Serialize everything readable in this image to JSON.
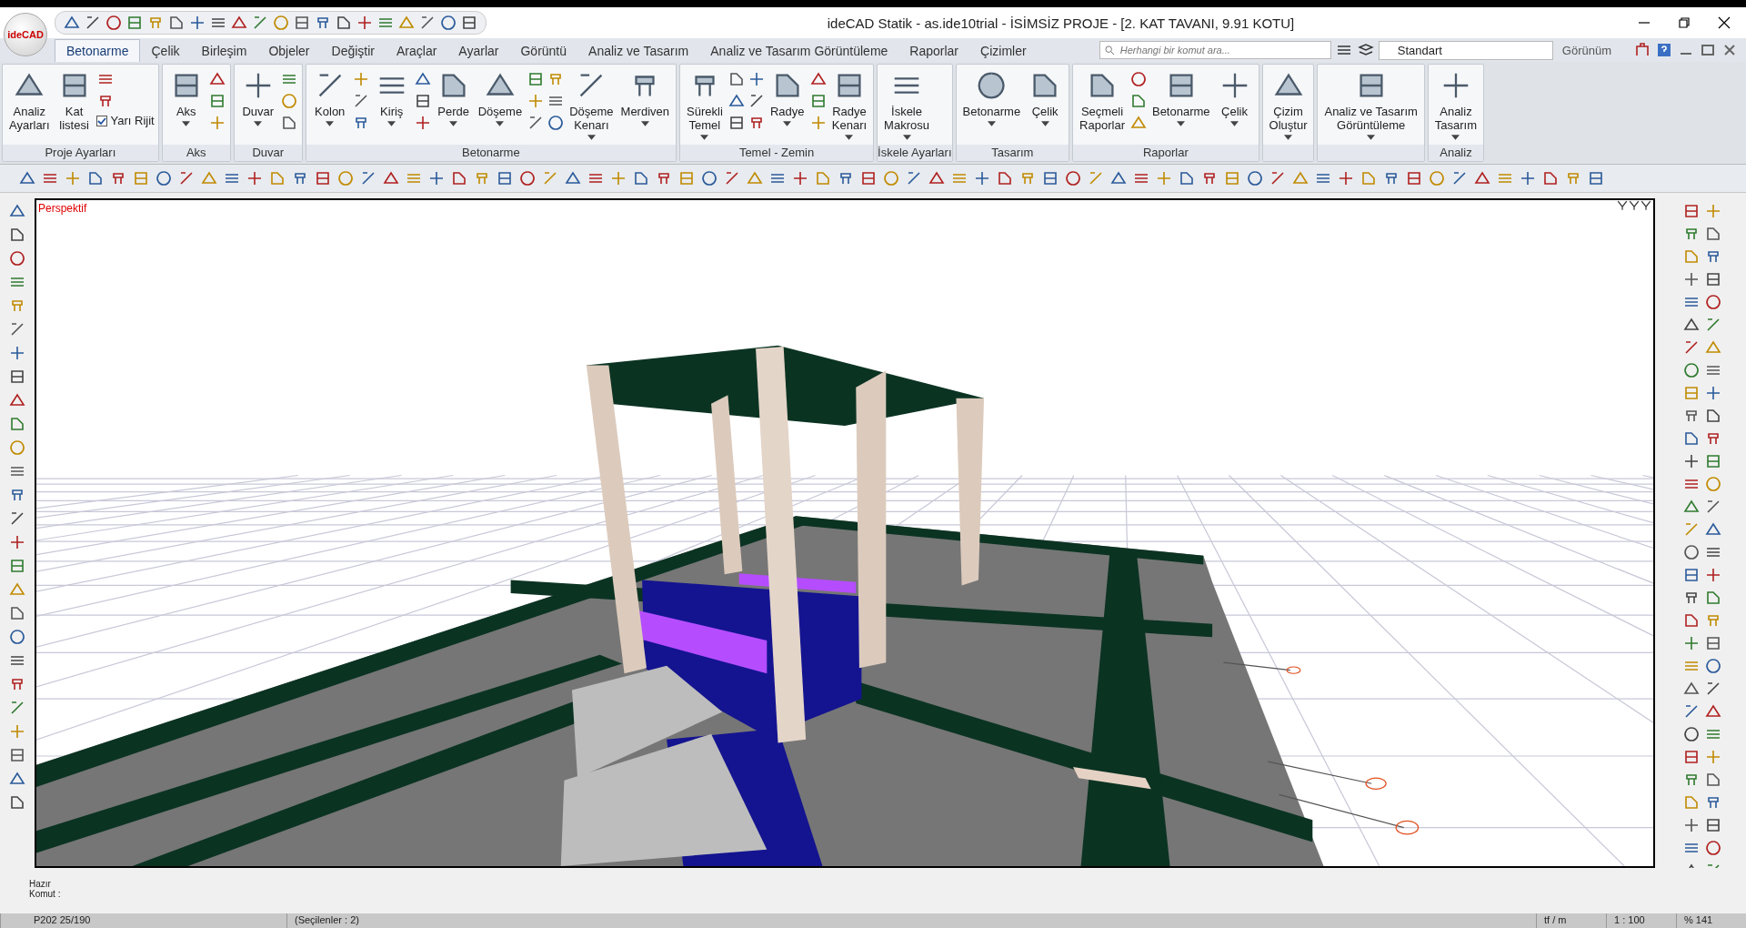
{
  "app": {
    "logo": "ideCAD",
    "title": "ideCAD Statik - as.ide10trial - İSİMSİZ PROJE - [2. KAT TAVANI,  9.91 KOTU]"
  },
  "tabs": [
    {
      "label": "Betonarme",
      "selected": true
    },
    {
      "label": "Çelik",
      "selected": false
    },
    {
      "label": "Birleşim",
      "selected": false
    },
    {
      "label": "Objeler",
      "selected": false
    },
    {
      "label": "Değiştir",
      "selected": false
    },
    {
      "label": "Araçlar",
      "selected": false
    },
    {
      "label": "Ayarlar",
      "selected": false
    },
    {
      "label": "Görüntü",
      "selected": false
    },
    {
      "label": "Analiz ve Tasarım",
      "selected": false
    },
    {
      "label": "Analiz ve Tasarım Görüntüleme",
      "selected": false
    },
    {
      "label": "Raporlar",
      "selected": false
    },
    {
      "label": "Çizimler",
      "selected": false
    }
  ],
  "search": {
    "placeholder": "Herhangi bir komut ara..."
  },
  "layer_select": {
    "value": "Standart"
  },
  "view_menu": {
    "label": "Görünüm"
  },
  "ribbon_groups": [
    {
      "title": "Proje Ayarları",
      "items": [
        {
          "kind": "large",
          "label": [
            "Analiz",
            "Ayarları"
          ],
          "dropdown": false
        },
        {
          "kind": "large",
          "label": [
            "Kat",
            "listesi"
          ],
          "dropdown": false
        },
        {
          "kind": "check",
          "label": "Yarı Rijit",
          "checked": true
        }
      ]
    },
    {
      "title": "Aks",
      "items": [
        {
          "kind": "large",
          "label": [
            "Aks"
          ],
          "dropdown": true
        },
        {
          "kind": "icons"
        }
      ]
    },
    {
      "title": "Duvar",
      "items": [
        {
          "kind": "large",
          "label": [
            "Duvar"
          ],
          "dropdown": true
        },
        {
          "kind": "icons"
        }
      ]
    },
    {
      "title": "Betonarme",
      "items": [
        {
          "kind": "large",
          "label": [
            "Kolon"
          ],
          "dropdown": true
        },
        {
          "kind": "icons"
        },
        {
          "kind": "large",
          "label": [
            "Kiriş"
          ],
          "dropdown": true
        },
        {
          "kind": "icons"
        },
        {
          "kind": "large",
          "label": [
            "Perde"
          ],
          "dropdown": true
        },
        {
          "kind": "large",
          "label": [
            "Döşeme"
          ],
          "dropdown": true
        },
        {
          "kind": "icons"
        },
        {
          "kind": "icons"
        },
        {
          "kind": "large",
          "label": [
            "Döşeme",
            "Kenarı"
          ],
          "dropdown": true
        },
        {
          "kind": "large",
          "label": [
            "Merdiven"
          ],
          "dropdown": true
        }
      ]
    },
    {
      "title": "Temel - Zemin",
      "items": [
        {
          "kind": "large",
          "label": [
            "Sürekli",
            "Temel"
          ],
          "dropdown": true
        },
        {
          "kind": "icons"
        },
        {
          "kind": "icons"
        },
        {
          "kind": "large",
          "label": [
            "Radye"
          ],
          "dropdown": true
        },
        {
          "kind": "icons"
        },
        {
          "kind": "large",
          "label": [
            "Radye",
            "Kenarı"
          ],
          "dropdown": true
        }
      ]
    },
    {
      "title": "İskele Ayarları",
      "items": [
        {
          "kind": "large",
          "label": [
            "İskele",
            "Makrosu"
          ],
          "dropdown": true
        }
      ]
    },
    {
      "title": "Tasarım",
      "items": [
        {
          "kind": "large",
          "label": [
            "Betonarme"
          ],
          "dropdown": true
        },
        {
          "kind": "large",
          "label": [
            "Çelik"
          ],
          "dropdown": true
        }
      ]
    },
    {
      "title": "Raporlar",
      "items": [
        {
          "kind": "large",
          "label": [
            "Seçmeli",
            "Raporlar"
          ],
          "dropdown": false
        },
        {
          "kind": "icons"
        },
        {
          "kind": "large",
          "label": [
            "Betonarme"
          ],
          "dropdown": true
        },
        {
          "kind": "large",
          "label": [
            "Çelik"
          ],
          "dropdown": true
        }
      ]
    },
    {
      "items": [
        {
          "kind": "large",
          "label": [
            "Çizim",
            "Oluştur"
          ],
          "dropdown": true
        }
      ]
    },
    {
      "items": [
        {
          "kind": "large",
          "label": [
            "Analiz ve Tasarım",
            "Görüntüleme"
          ],
          "dropdown": true
        }
      ]
    },
    {
      "title": "Analiz",
      "items": [
        {
          "kind": "large",
          "label": [
            "Analiz",
            "Tasarım"
          ],
          "dropdown": true
        }
      ]
    }
  ],
  "viewport": {
    "label": "Perspektif"
  },
  "command": {
    "status": "Hazır",
    "prompt": "Komut :"
  },
  "status_bar": [
    "P202 25/190",
    "(Seçilenler : 2)",
    "tf / m",
    "1 : 100",
    "% 141"
  ]
}
